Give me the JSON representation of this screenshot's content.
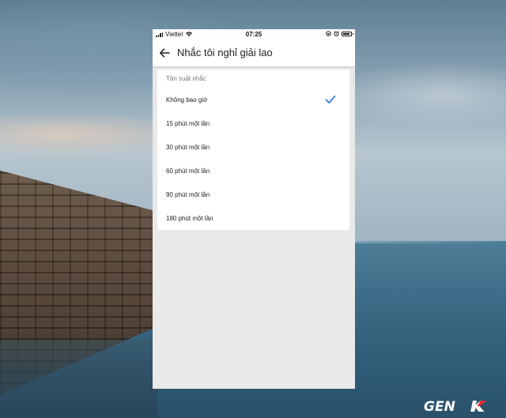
{
  "status_bar": {
    "carrier": "Viettel",
    "time": "07:25"
  },
  "app_bar": {
    "title": "Nhắc tôi nghỉ giải lao"
  },
  "settings": {
    "section_label": "Tần suất nhắc",
    "options": [
      {
        "label": "Không bao giờ",
        "selected": true
      },
      {
        "label": "15 phút một lần",
        "selected": false
      },
      {
        "label": "30 phút một lần",
        "selected": false
      },
      {
        "label": "60 phút một lần",
        "selected": false
      },
      {
        "label": "90 phút một lần",
        "selected": false
      },
      {
        "label": "180 phút một lần",
        "selected": false
      }
    ]
  },
  "watermark": {
    "text": "GENK"
  },
  "colors": {
    "accent": "#2f7fd6",
    "watermark_accent": "#e8262b"
  },
  "icons": [
    "signal-icon",
    "wifi-icon",
    "lock-rotation-icon",
    "alarm-icon",
    "battery-icon",
    "back-arrow-icon",
    "check-icon"
  ]
}
